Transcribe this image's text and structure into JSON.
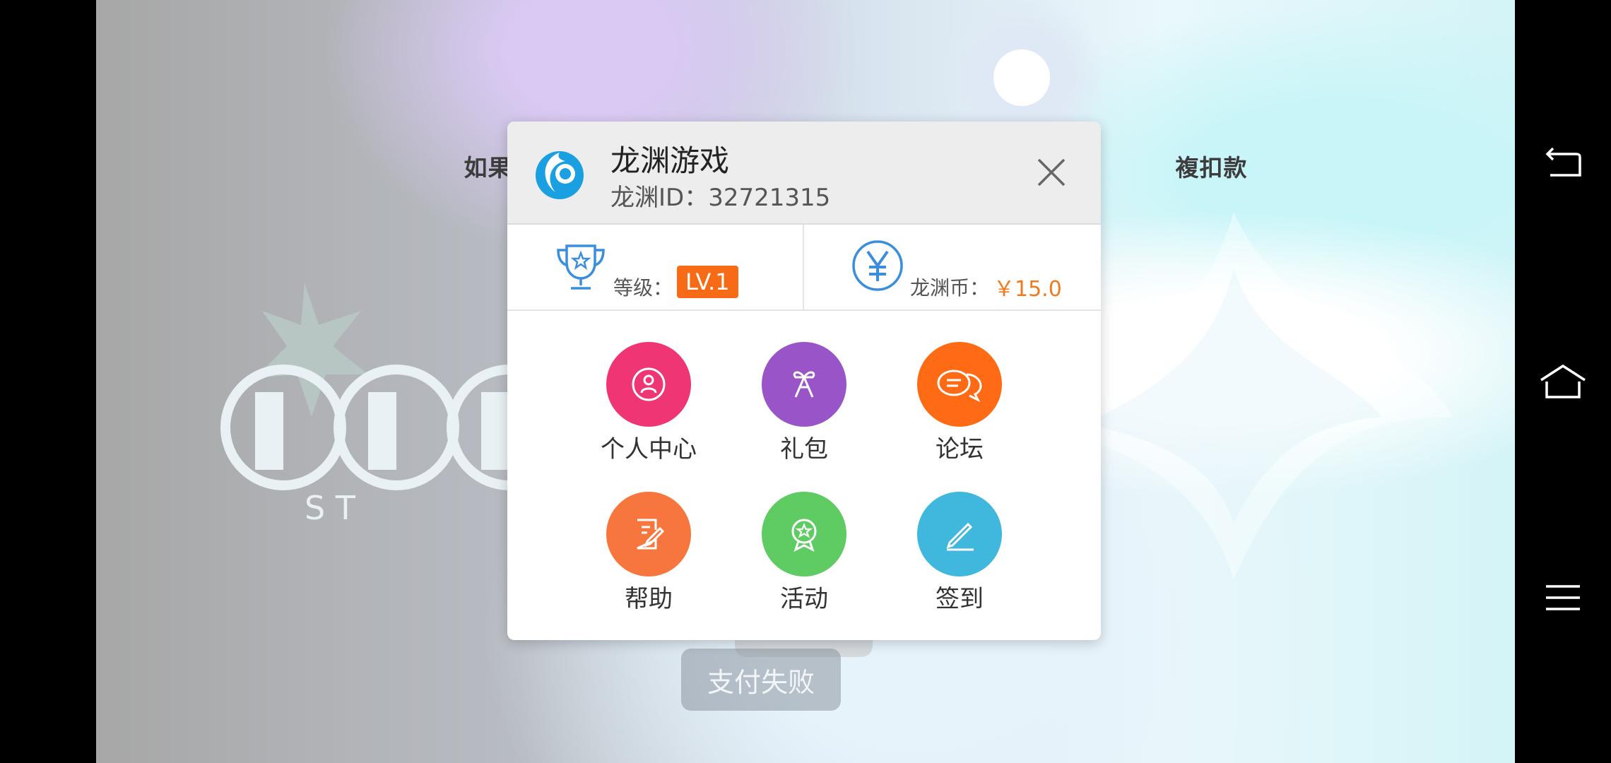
{
  "background": {
    "notice_left": "如果您",
    "notice_right": "複扣款",
    "logo_letters": "S   T",
    "pay_status": "支付失败"
  },
  "panel": {
    "title": "龙渊游戏",
    "id_label": "龙渊ID：",
    "id_value": "32721315",
    "level_label": "等级：",
    "level_value": "LV.1",
    "coin_label": "龙渊币：",
    "coin_value": "￥15.0",
    "grid": [
      {
        "label": "个人中心",
        "icon": "user-icon",
        "color": "#ef3573"
      },
      {
        "label": "礼包",
        "icon": "gift-icon",
        "color": "#9955c8"
      },
      {
        "label": "论坛",
        "icon": "chat-icon",
        "color": "#ff6a14"
      },
      {
        "label": "帮助",
        "icon": "help-edit-icon",
        "color": "#f7763d"
      },
      {
        "label": "活动",
        "icon": "badge-icon",
        "color": "#5fcc63"
      },
      {
        "label": "签到",
        "icon": "pen-icon",
        "color": "#40b7dc"
      }
    ]
  },
  "navigation": {
    "back": "back-icon",
    "home": "home-icon",
    "menu": "menu-icon"
  },
  "colors": {
    "accent_orange": "#f76b17",
    "coin_orange": "#f07a1e",
    "icon_blue": "#3a8edb"
  }
}
